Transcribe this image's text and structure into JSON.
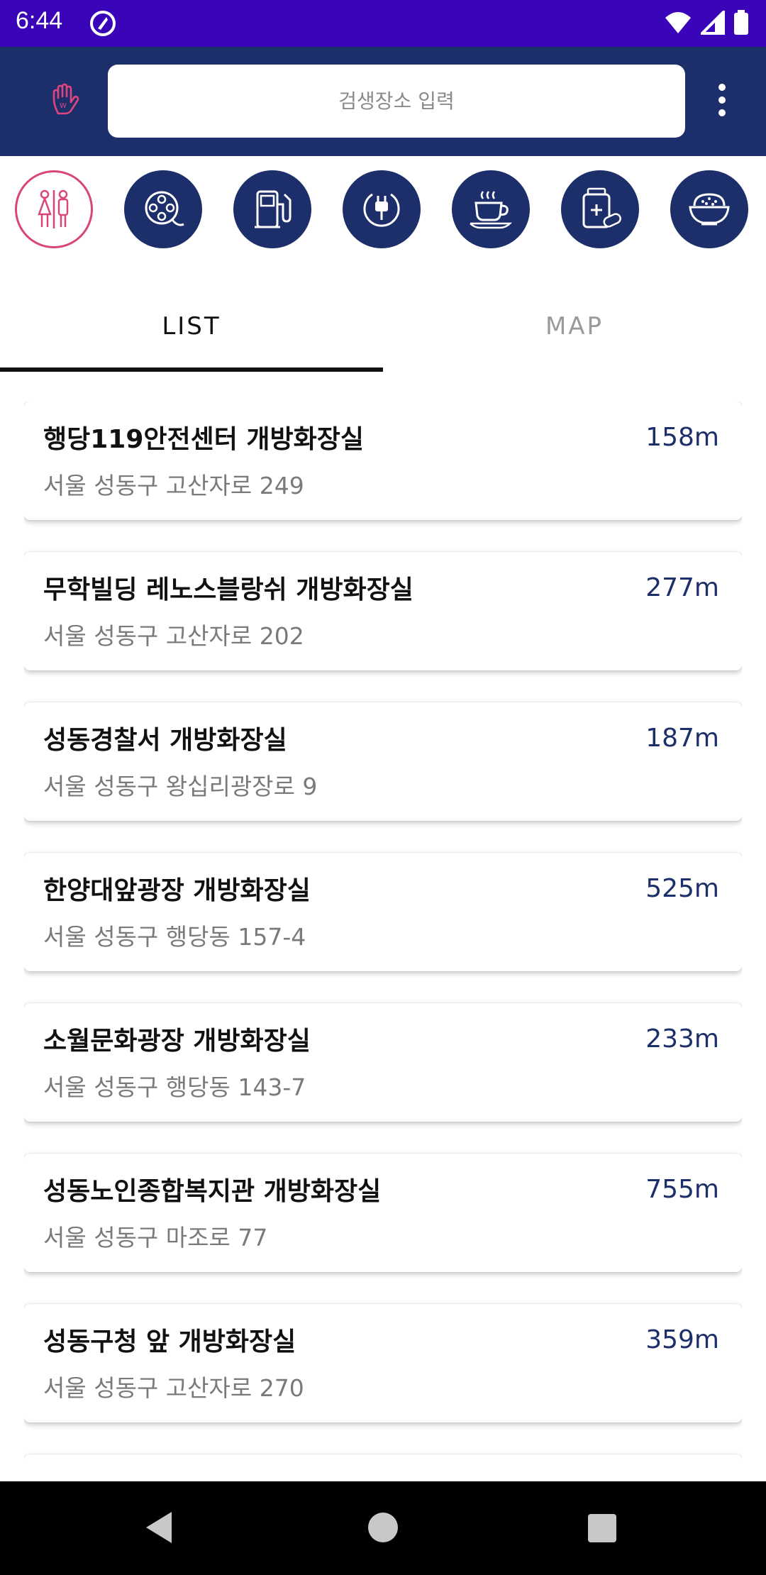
{
  "status_bar": {
    "time": "6:44"
  },
  "search": {
    "placeholder": "검생장소 입력"
  },
  "categories": [
    {
      "icon": "restroom-icon",
      "active": true
    },
    {
      "icon": "film-reel-icon",
      "active": false
    },
    {
      "icon": "gas-station-icon",
      "active": false
    },
    {
      "icon": "ev-charger-icon",
      "active": false
    },
    {
      "icon": "coffee-cup-icon",
      "active": false
    },
    {
      "icon": "pharmacy-icon",
      "active": false
    },
    {
      "icon": "rice-bowl-icon",
      "active": false
    }
  ],
  "tabs": {
    "list_label": "LIST",
    "map_label": "MAP"
  },
  "places": [
    {
      "name": "행당119안전센터 개방화장실",
      "address": "서울 성동구 고산자로 249",
      "distance": "158m"
    },
    {
      "name": "무학빌딩 레노스블랑쉬 개방화장실",
      "address": "서울 성동구 고산자로 202",
      "distance": "277m"
    },
    {
      "name": "성동경찰서 개방화장실",
      "address": "서울 성동구 왕십리광장로 9",
      "distance": "187m"
    },
    {
      "name": "한양대앞광장 개방화장실",
      "address": "서울 성동구 행당동 157-4",
      "distance": "525m"
    },
    {
      "name": "소월문화광장 개방화장실",
      "address": "서울 성동구 행당동 143-7",
      "distance": "233m"
    },
    {
      "name": "성동노인종합복지관 개방화장실",
      "address": "서울 성동구 마조로 77",
      "distance": "755m"
    },
    {
      "name": "성동구청 앞 개방화장실",
      "address": "서울 성동구 고산자로 270",
      "distance": "359m"
    }
  ],
  "colors": {
    "status_bar": "#3a05b8",
    "app_bar": "#1d2f6b",
    "accent_pink": "#d9457a",
    "distance_text": "#1d2f6b"
  }
}
